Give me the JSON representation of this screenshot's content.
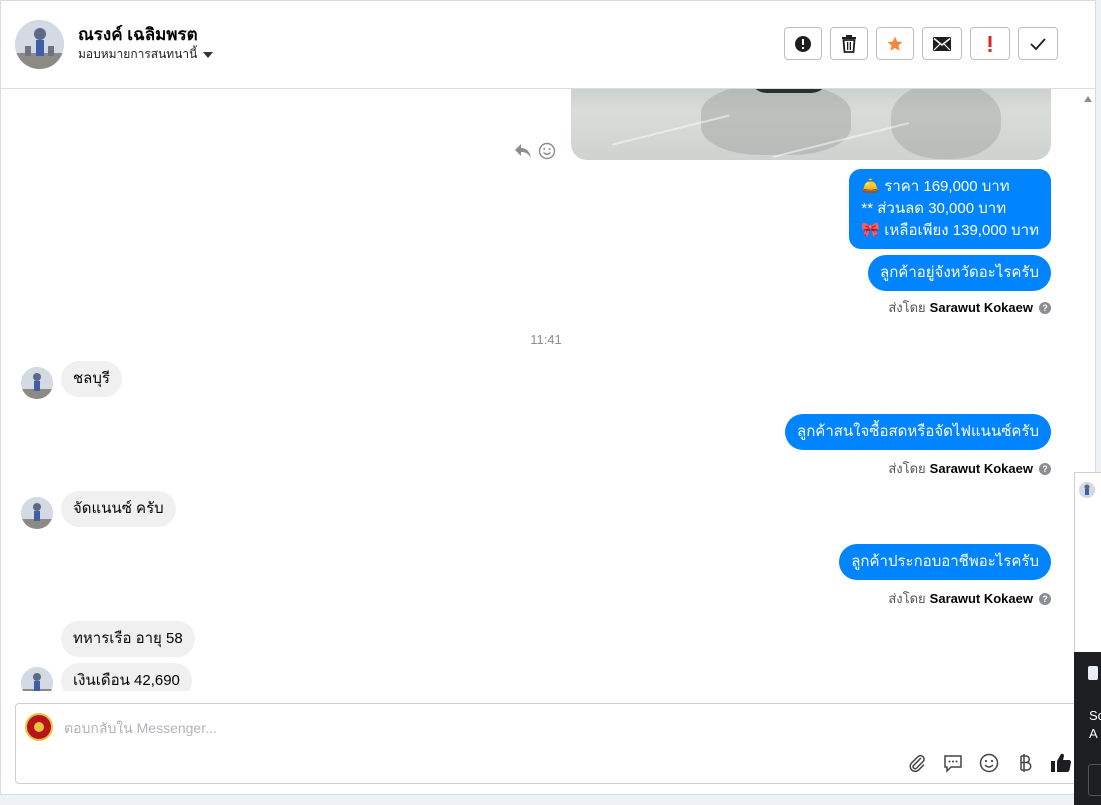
{
  "header": {
    "name": "ณรงค์ เฉลิมพรต",
    "subtitle": "มอบหมายการสนทนานี้",
    "tools": [
      "report-icon",
      "trash-icon",
      "star-icon",
      "mail-icon",
      "important-icon",
      "check-icon"
    ],
    "colors": {
      "star": "#f5883c",
      "important": "#e02424"
    }
  },
  "messages": {
    "price_line1": "🛎️ ราคา 169,000 บาท",
    "price_line2": "** ส่วนลด 30,000 บาท",
    "price_line3": "🎀 เหลือเพียง 139,000 บาท",
    "out_province": "ลูกค้าอยู่จังหวัดอะไรครับ",
    "time": "11:41",
    "in_city": "ชลบุรี",
    "out_payment": "ลูกค้าสนใจซื้อสดหรือจัดไฟแนนซ์ครับ",
    "in_finance": "จัดแนนซ์ ครับ",
    "out_job": "ลูกค้าประกอบอาชีพอะไรครับ",
    "in_job": "ทหารเรือ อายุ 58",
    "in_salary": "เงินเดือน 42,690"
  },
  "sent_by": {
    "prefix": "ส่งโดย",
    "agent": "Sarawut Kokaew"
  },
  "composer": {
    "placeholder": "ตอบกลับใน Messenger...",
    "tools": [
      "attach-icon",
      "saved-reply-icon",
      "emoji-icon",
      "baht-icon",
      "like-icon"
    ]
  },
  "side_panel": {
    "line1": "Sc",
    "line2": "A"
  },
  "colors": {
    "outgoing_bubble": "#0084ff",
    "incoming_bubble": "#f0f0f0"
  }
}
